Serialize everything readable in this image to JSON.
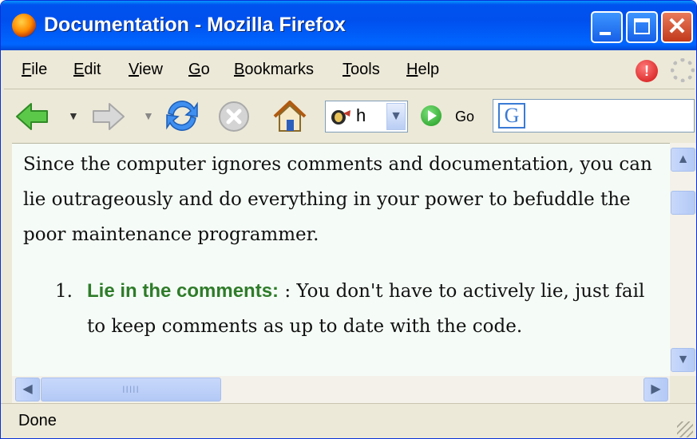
{
  "window": {
    "title": "Documentation - Mozilla Firefox",
    "close_glyph": "✕"
  },
  "menu": {
    "items": [
      "File",
      "Edit",
      "View",
      "Go",
      "Bookmarks",
      "Tools",
      "Help"
    ]
  },
  "toolbar": {
    "url_text": "h",
    "go_label": "Go",
    "search_engine_glyph": "G"
  },
  "content": {
    "paragraph": "Since the computer ignores comments and documentation, you can lie outrageously and do everything in your power to befuddle the poor maintenance programmer.",
    "list": [
      {
        "number": "1.",
        "term": "Lie in the comments:",
        "text": " : You don't have to actively lie, just fail to keep comments as up to date with the code."
      }
    ]
  },
  "status": {
    "text": "Done"
  },
  "colors": {
    "titlebar": "#0053ee",
    "term_green": "#2f7c2a",
    "content_bg": "#f5fcf7",
    "chrome": "#ece9d8"
  },
  "icons": [
    "firefox-icon",
    "back-arrow-icon",
    "forward-arrow-icon",
    "reload-icon",
    "stop-icon",
    "home-icon",
    "go-icon",
    "google-icon",
    "alert-icon",
    "throbber-icon"
  ]
}
